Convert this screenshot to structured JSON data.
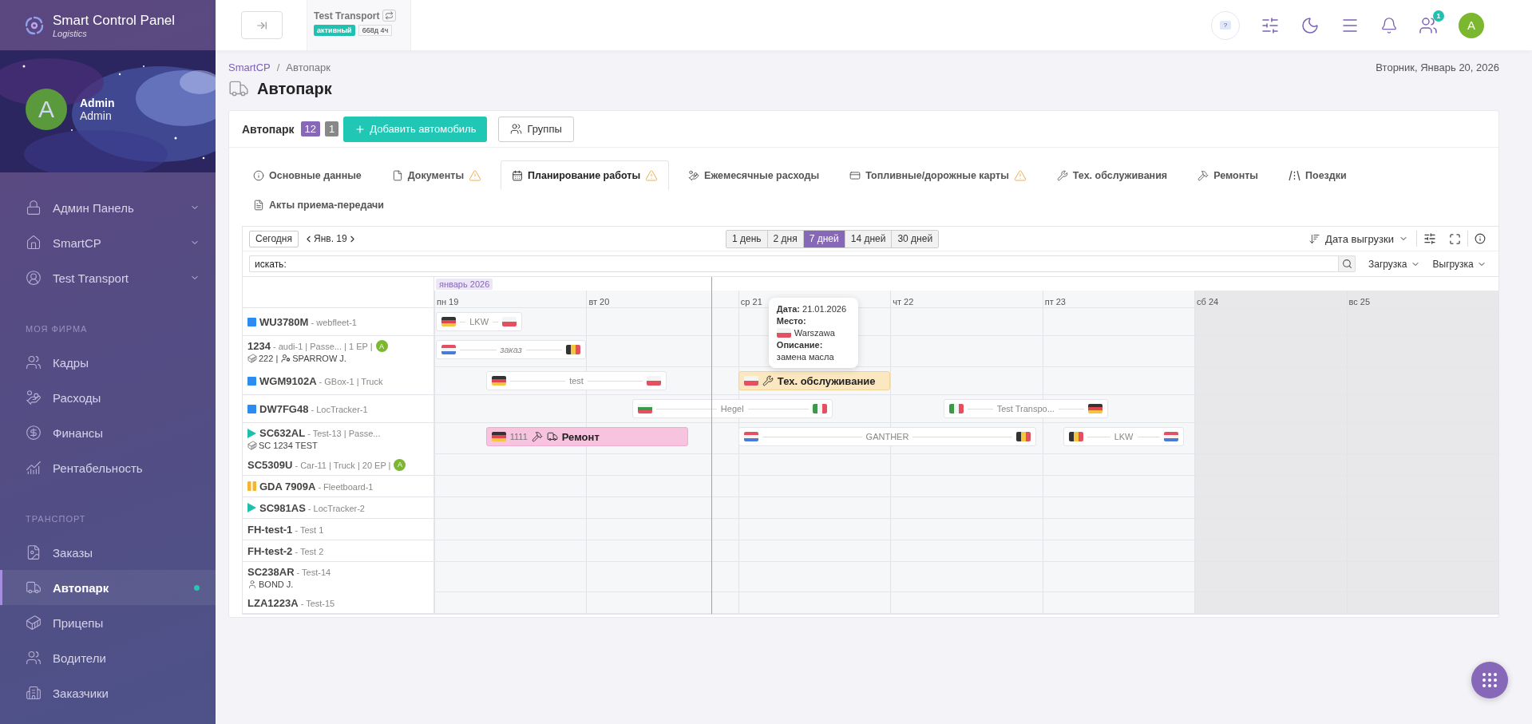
{
  "sidebar": {
    "brand": {
      "title": "Smart Control Panel",
      "subtitle": "Logistics"
    },
    "user": {
      "avatar": "A",
      "name": "Admin",
      "role": "Admin"
    },
    "sections": [
      {
        "items": [
          {
            "label": "Админ Панель",
            "expanded": false,
            "selected": false
          },
          {
            "label": "SmartCP",
            "expanded": false,
            "selected": false
          },
          {
            "label": "Test Transport",
            "expanded": false,
            "selected": false
          }
        ]
      },
      {
        "heading": "МОЯ ФИРМА",
        "items": [
          {
            "label": "Кадры",
            "selected": false
          },
          {
            "label": "Расходы",
            "selected": false
          },
          {
            "label": "Финансы",
            "selected": false
          },
          {
            "label": "Рентабельность",
            "selected": false
          }
        ]
      },
      {
        "heading": "ТРАНСПОРТ",
        "items": [
          {
            "label": "Заказы",
            "selected": false
          },
          {
            "label": "Автопарк",
            "selected": true
          },
          {
            "label": "Прицепы",
            "selected": false
          },
          {
            "label": "Водители",
            "selected": false
          },
          {
            "label": "Заказчики",
            "selected": false
          }
        ]
      }
    ]
  },
  "topbar": {
    "company": {
      "name": "Test Transport",
      "status": "активный",
      "uptime": "668д 4ч"
    },
    "help": "?",
    "users_badge": "1",
    "avatar": "A"
  },
  "breadcrumbs": [
    "SmartCP",
    "/",
    "Автопарк"
  ],
  "date": "Вторник, Январь 20, 2026",
  "title": "Автопарк",
  "card": {
    "title": "Автопарк",
    "counts": [
      "12",
      "1"
    ],
    "add_button": "Добавить автомобиль",
    "groups_button": "Группы"
  },
  "tabs": [
    {
      "label": "Основные данные",
      "warning": false,
      "selected": false
    },
    {
      "label": "Документы",
      "warning": true,
      "selected": false
    },
    {
      "label": "Планирование работы",
      "warning": true,
      "selected": true
    },
    {
      "label": "Ежемесячные расходы",
      "warning": false,
      "selected": false
    },
    {
      "label": "Топливные/дорожные карты",
      "warning": true,
      "selected": false
    },
    {
      "label": "Тех. обслуживания",
      "warning": false,
      "selected": false
    },
    {
      "label": "Ремонты",
      "warning": false,
      "selected": false
    },
    {
      "label": "Поездки",
      "warning": false,
      "selected": false
    },
    {
      "label": "Акты приема-передачи",
      "warning": false,
      "selected": false
    }
  ],
  "planner": {
    "today": "Сегодня",
    "period": "Янв. 19",
    "ranges": [
      {
        "label": "1 день",
        "selected": false
      },
      {
        "label": "2 дня",
        "selected": false
      },
      {
        "label": "7 дней",
        "selected": true
      },
      {
        "label": "14 дней",
        "selected": false
      },
      {
        "label": "30 дней",
        "selected": false
      }
    ],
    "sort": "Дата выгрузки",
    "search": {
      "placeholder": "искать:"
    },
    "filters": [
      "Загрузка",
      "Выгрузка"
    ],
    "month": "январь 2026",
    "days": [
      {
        "label": "пн 19",
        "weekend": false
      },
      {
        "label": "вт 20",
        "weekend": false
      },
      {
        "label": "ср 21",
        "weekend": false
      },
      {
        "label": "чт 22",
        "weekend": false
      },
      {
        "label": "пт 23",
        "weekend": false
      },
      {
        "label": "сб 24",
        "weekend": true
      },
      {
        "label": "вс 25",
        "weekend": true
      }
    ],
    "vehicles": [
      {
        "title": "**WU3780M** - webfleet-1",
        "kind": "square",
        "color": "#2d8cf0",
        "bars": [
          {
            "kind": "trip",
            "from": {
              "kind": "de"
            },
            "to": {
              "kind": "pl"
            },
            "label": "LKW"
          }
        ]
      },
      {
        "title": "**1234** - audi-1 | Passe... | 1 EP |",
        "avatar": "A",
        "sub": [
          {
            "kind": "trailer",
            "text": "222 |"
          },
          {
            "kind": "driver",
            "text": "SPARROW J."
          }
        ],
        "bars": [
          {
            "kind": "order",
            "from": {
              "kind": "nl"
            },
            "to": {
              "kind": "be"
            },
            "label": "заказ"
          }
        ]
      },
      {
        "title": "**WGM9102A** - GBox-1 | Truck",
        "kind": "square",
        "color": "#2d8cf0",
        "bars": [
          {
            "kind": "trip",
            "from": {
              "kind": "de"
            },
            "to": {
              "kind": "pl"
            },
            "label": "test"
          },
          {
            "kind": "maintenance",
            "from": {
              "kind": "pl"
            },
            "label": "Тех. обслуживание",
            "tooltip": {
              "date_label": "Дата:",
              "date": "21.01.2026",
              "place_label": "Место:",
              "place_flag": {
                "kind": "pl"
              },
              "place": "Warszawa",
              "desc_label": "Описание:",
              "desc": "замена масла"
            }
          }
        ]
      },
      {
        "title": "**DW7FG48** - LocTracker-1",
        "kind": "square",
        "color": "#2d8cf0",
        "bars": [
          {
            "kind": "trip",
            "from": {
              "kind": "bg"
            },
            "to": {
              "kind": "it"
            },
            "label": "Hegel"
          },
          {
            "kind": "trip",
            "from": {
              "kind": "it"
            },
            "to": {
              "kind": "de"
            },
            "label": "Test Transpo..."
          }
        ]
      },
      {
        "title": "**SC632AL** - Test-13 | Passe...",
        "kind": "play",
        "color": "#1fbfae",
        "sub": [
          {
            "kind": "trailer",
            "text": "SC 1234 TEST"
          }
        ],
        "bars": [
          {
            "kind": "repair",
            "from": {
              "kind": "de"
            },
            "code": "1111",
            "label": "Ремонт"
          },
          {
            "kind": "trip",
            "from": {
              "kind": "nl"
            },
            "to": {
              "kind": "be"
            },
            "label": "GANTHER"
          },
          {
            "kind": "trip",
            "from": {
              "kind": "be"
            },
            "to": {
              "kind": "nl"
            },
            "label": "LKW"
          }
        ]
      },
      {
        "title": "**SC5309U** - Car-11 | Truck | 20 EP |",
        "avatar": "A"
      },
      {
        "title": "**GDA 7909A** - Fleetboard-1",
        "kind": "pause",
        "color": "#f5b52e"
      },
      {
        "title": "**SC981AS** - LocTracker-2",
        "kind": "play",
        "color": "#1fbfae"
      },
      {
        "title": "**FH-test-1** - Test 1"
      },
      {
        "title": "**FH-test-2** - Test 2"
      },
      {
        "title": "**SC238AR** - Test-14",
        "sub": [
          {
            "kind": "driver",
            "text": "BOND J."
          }
        ]
      },
      {
        "title": "**LZA1223A** - Test-15"
      }
    ]
  }
}
